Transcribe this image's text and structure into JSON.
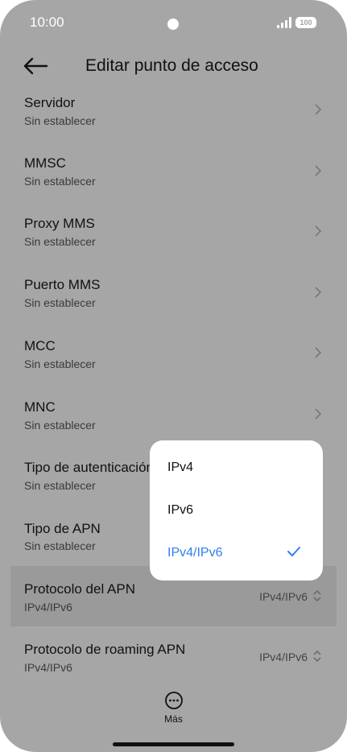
{
  "status": {
    "time": "10:00",
    "battery": "100"
  },
  "header": {
    "title": "Editar punto de acceso",
    "back_icon": "arrow-left-icon"
  },
  "list": [
    {
      "label": "Servidor",
      "sub": "Sin establecer"
    },
    {
      "label": "MMSC",
      "sub": "Sin establecer"
    },
    {
      "label": "Proxy MMS",
      "sub": "Sin establecer"
    },
    {
      "label": "Puerto MMS",
      "sub": "Sin establecer"
    },
    {
      "label": "MCC",
      "sub": "Sin establecer"
    },
    {
      "label": "MNC",
      "sub": "Sin establecer"
    },
    {
      "label": "Tipo de autenticación",
      "sub": "Sin establecer"
    },
    {
      "label": "Tipo de APN",
      "sub": "Sin establecer"
    },
    {
      "label": "Protocolo del APN",
      "sub": "IPv4/IPv6",
      "value": "IPv4/IPv6"
    },
    {
      "label": "Protocolo de roaming APN",
      "sub": "IPv4/IPv6",
      "value": "IPv4/IPv6"
    }
  ],
  "popup": {
    "options": [
      "IPv4",
      "IPv6",
      "IPv4/IPv6"
    ],
    "selected": "IPv4/IPv6",
    "accent": "#2f80ed"
  },
  "bottom": {
    "more_label": "Más",
    "more_icon": "ellipsis-circle-icon"
  }
}
